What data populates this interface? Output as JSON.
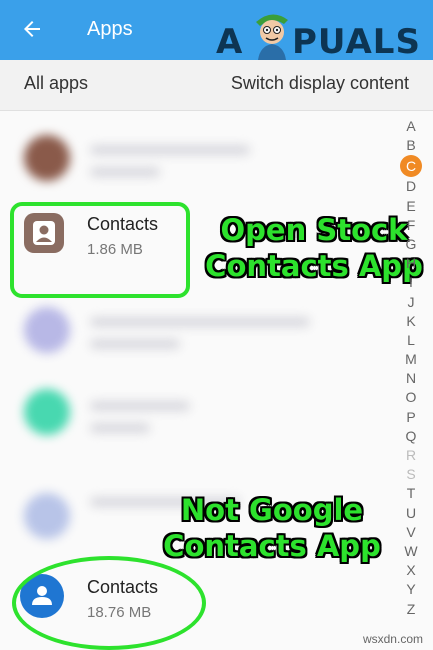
{
  "appbar": {
    "title": "Apps",
    "logo_a": "A",
    "logo_rest": "PUALS"
  },
  "toolbar": {
    "all_apps_label": "All apps",
    "switch_label": "Switch display content"
  },
  "apps": [
    {
      "name": "Contacts",
      "size": "1.86 MB",
      "icon": "stock-contacts-icon"
    },
    {
      "name": "Contacts",
      "size": "18.76 MB",
      "icon": "google-contacts-icon"
    }
  ],
  "annotations": {
    "stock_line1": "Open Stock",
    "stock_line2": "Contacts App",
    "google_line1": "Not Google",
    "google_line2": "Contacts App"
  },
  "alpha_index": [
    "A",
    "B",
    "C",
    "D",
    "E",
    "F",
    "G",
    "H",
    "I",
    "J",
    "K",
    "L",
    "M",
    "N",
    "O",
    "P",
    "Q",
    "R",
    "S",
    "T",
    "U",
    "V",
    "W",
    "X",
    "Y",
    "Z"
  ],
  "alpha_active": "C",
  "watermark": "wsxdn.com",
  "colors": {
    "appbar": "#3aa0ea",
    "annotation": "#2de22d",
    "index_active": "#f08a24"
  }
}
